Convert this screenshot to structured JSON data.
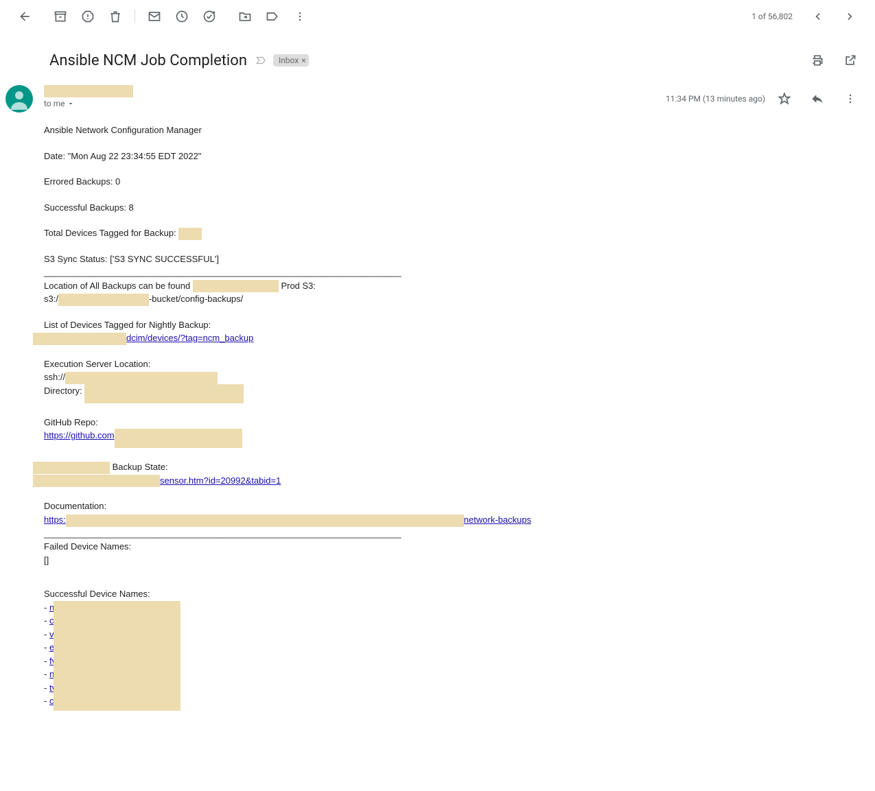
{
  "toolbar": {
    "counter": "1 of 56,802"
  },
  "subject": {
    "title": "Ansible NCM Job Completion",
    "label": "Inbox"
  },
  "sender": {
    "to_line": "to me"
  },
  "meta": {
    "timestamp": "11:34 PM (13 minutes ago)"
  },
  "body": {
    "l1": "Ansible Network Configuration Manager",
    "l2": "Date: \"Mon Aug 22 23:34:55 EDT 2022\"",
    "l3": "Errored Backups: 0",
    "l4": "Successful Backups: 8",
    "l5_pre": "Total Devices Tagged for Backup: ",
    "l6": "S3 Sync Status: ['S3 SYNC SUCCESSFUL']",
    "hr": "________________________________________________________________________",
    "l7_pre": "Location of All Backups can be found ",
    "l7_post": " Prod S3:",
    "l8_pre": "s3:/",
    "l8_post": "-bucket/config-backups/",
    "l9": "List of Devices Tagged for Nightly Backup:",
    "link1": "dcim/devices/?tag=ncm_backup",
    "l10": "Execution Server Location:",
    "l11_pre": "ssh://",
    "l12_pre": "Directory: ",
    "l13": "GitHub Repo:",
    "link2": "https://github.com",
    "l14_post": " Backup State:",
    "link3": "sensor.htm?id=20992&tabid=1",
    "l15": "Documentation:",
    "link4_pre": "https:",
    "link4_post": "network-backups",
    "l16": "Failed Device Names:",
    "l17": "[]",
    "l18": "Successful Device Names:",
    "d1": "n",
    "d2": "c",
    "d3": "v",
    "d4": "e",
    "d5": "fv",
    "d6": "n",
    "d7": "tv",
    "d8": "c"
  }
}
